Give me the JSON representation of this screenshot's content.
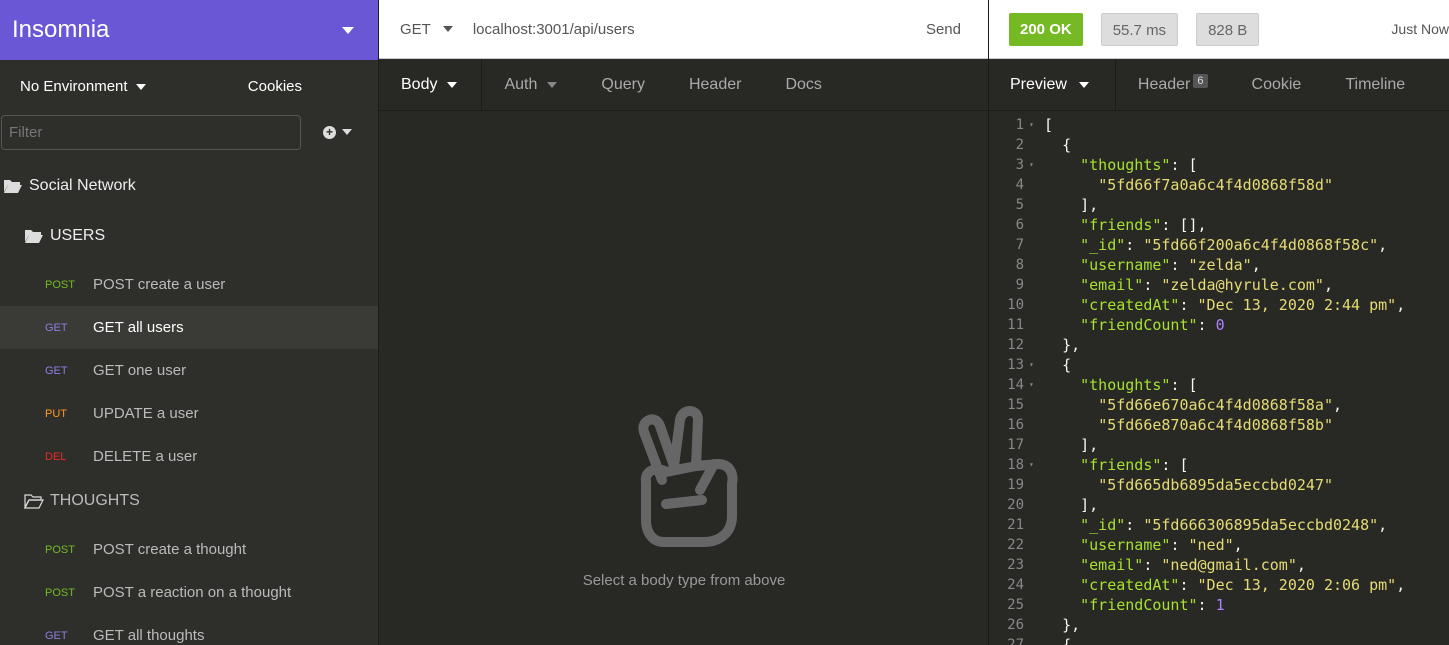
{
  "sidebar": {
    "app_title": "Insomnia",
    "environment": "No Environment",
    "cookies": "Cookies",
    "filter_placeholder": "Filter",
    "workspace": "Social Network",
    "folders": [
      {
        "name": "USERS"
      },
      {
        "name": "THOUGHTS"
      }
    ],
    "requests": [
      {
        "method": "POST",
        "label": "POST create a user",
        "active": false
      },
      {
        "method": "GET",
        "label": "GET all users",
        "active": true
      },
      {
        "method": "GET",
        "label": "GET one user",
        "active": false
      },
      {
        "method": "PUT",
        "label": "UPDATE a user",
        "active": false
      },
      {
        "method": "DEL",
        "label": "DELETE a user",
        "active": false
      },
      {
        "method": "POST",
        "label": "POST create a thought",
        "active": false
      },
      {
        "method": "POST",
        "label": "POST a reaction on a thought",
        "active": false
      },
      {
        "method": "GET",
        "label": "GET all thoughts",
        "active": false
      }
    ]
  },
  "request": {
    "method": "GET",
    "url": "localhost:3001/api/users",
    "send": "Send",
    "tabs": [
      "Body",
      "Auth",
      "Query",
      "Header",
      "Docs"
    ],
    "active_tab": "Body",
    "empty_message": "Select a body type from above"
  },
  "response": {
    "status": "200 OK",
    "time": "55.7 ms",
    "size": "828 B",
    "received": "Just Now",
    "tabs": [
      "Preview",
      "Header",
      "Cookie",
      "Timeline"
    ],
    "header_count": "6",
    "lines": [
      "[",
      "  {",
      "    \"thoughts\": [",
      "      \"5fd66f7a0a6c4f4d0868f58d\"",
      "    ],",
      "    \"friends\": [],",
      "    \"_id\": \"5fd66f200a6c4f4d0868f58c\",",
      "    \"username\": \"zelda\",",
      "    \"email\": \"zelda@hyrule.com\",",
      "    \"createdAt\": \"Dec 13, 2020 2:44 pm\",",
      "    \"friendCount\": 0",
      "  },",
      "  {",
      "    \"thoughts\": [",
      "      \"5fd66e670a6c4f4d0868f58a\",",
      "      \"5fd66e870a6c4f4d0868f58b\"",
      "    ],",
      "    \"friends\": [",
      "      \"5fd665db6895da5eccbd0247\"",
      "    ],",
      "    \"_id\": \"5fd666306895da5eccbd0248\",",
      "    \"username\": \"ned\",",
      "    \"email\": \"ned@gmail.com\",",
      "    \"createdAt\": \"Dec 13, 2020 2:06 pm\",",
      "    \"friendCount\": 1",
      "  },",
      "  {"
    ],
    "foldable_lines": [
      1,
      3,
      13,
      14,
      18
    ]
  },
  "colors": {
    "brand": "#6a57d5",
    "ok": "#75ba24",
    "post": "#75ba24",
    "get": "#8d7ee0",
    "put": "#ff9a1f",
    "del": "#ec2929"
  }
}
